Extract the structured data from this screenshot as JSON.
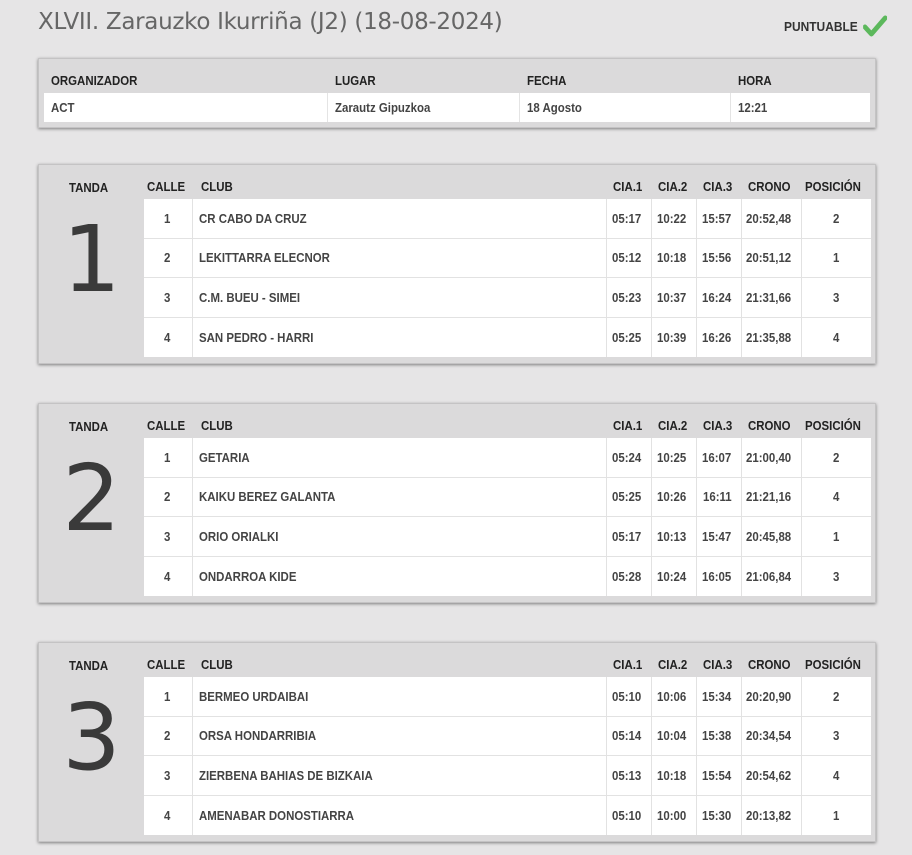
{
  "page": {
    "title": "XLVII. Zarauzko Ikurriña (J2) (18-08-2024)",
    "puntuable_label": "PUNTUABLE",
    "check_color": "#5cb85c"
  },
  "info": {
    "headers": [
      "ORGANIZADOR",
      "LUGAR",
      "FECHA",
      "HORA"
    ],
    "values": [
      "ACT",
      "Zarautz Gipuzkoa",
      "18 Agosto",
      "12:21"
    ]
  },
  "heat_columns": [
    "CALLE",
    "CLUB",
    "CIA.1",
    "CIA.2",
    "CIA.3",
    "CRONO",
    "POSICIÓN"
  ],
  "tanda_label": "TANDA",
  "heats": [
    {
      "number": "1",
      "rows": [
        [
          "1",
          "CR CABO DA CRUZ",
          "05:17",
          "10:22",
          "15:57",
          "20:52,48",
          "2"
        ],
        [
          "2",
          "LEKITTARRA ELECNOR",
          "05:12",
          "10:18",
          "15:56",
          "20:51,12",
          "1"
        ],
        [
          "3",
          "C.M. BUEU - SIMEI",
          "05:23",
          "10:37",
          "16:24",
          "21:31,66",
          "3"
        ],
        [
          "4",
          "SAN PEDRO - HARRI",
          "05:25",
          "10:39",
          "16:26",
          "21:35,88",
          "4"
        ]
      ]
    },
    {
      "number": "2",
      "rows": [
        [
          "1",
          "GETARIA",
          "05:24",
          "10:25",
          "16:07",
          "21:00,40",
          "2"
        ],
        [
          "2",
          "KAIKU BEREZ GALANTA",
          "05:25",
          "10:26",
          "16:11",
          "21:21,16",
          "4"
        ],
        [
          "3",
          "ORIO ORIALKI",
          "05:17",
          "10:13",
          "15:47",
          "20:45,88",
          "1"
        ],
        [
          "4",
          "ONDARROA KIDE",
          "05:28",
          "10:24",
          "16:05",
          "21:06,84",
          "3"
        ]
      ]
    },
    {
      "number": "3",
      "rows": [
        [
          "1",
          "BERMEO URDAIBAI",
          "05:10",
          "10:06",
          "15:34",
          "20:20,90",
          "2"
        ],
        [
          "2",
          "ORSA HONDARRIBIA",
          "05:14",
          "10:04",
          "15:38",
          "20:34,54",
          "3"
        ],
        [
          "3",
          "ZIERBENA BAHIAS DE BIZKAIA",
          "05:13",
          "10:18",
          "15:54",
          "20:54,62",
          "4"
        ],
        [
          "4",
          "AMENABAR DONOSTIARRA",
          "05:10",
          "10:00",
          "15:30",
          "20:13,82",
          "1"
        ]
      ]
    }
  ]
}
